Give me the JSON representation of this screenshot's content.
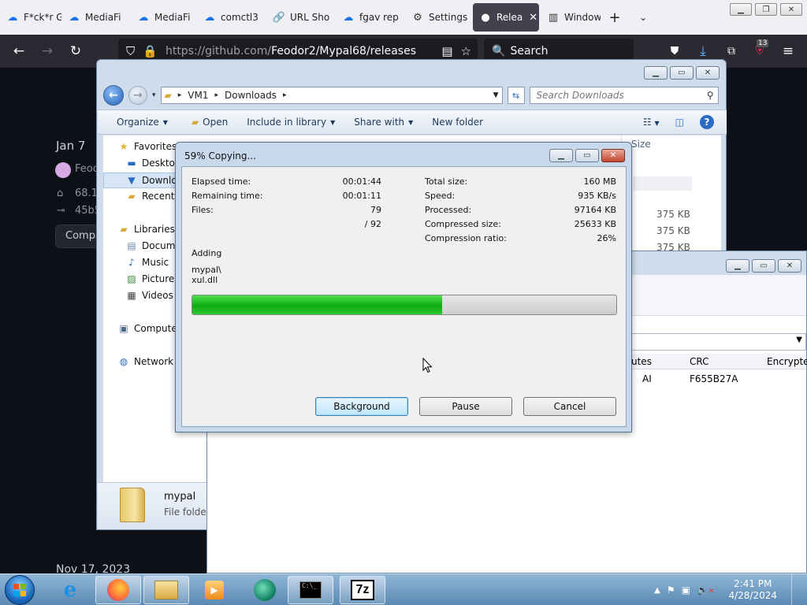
{
  "browser": {
    "tabs": [
      {
        "label": "F*ck*r G",
        "icon": "cloud-icon"
      },
      {
        "label": "MediaFi",
        "icon": "cloud-icon"
      },
      {
        "label": "MediaFi",
        "icon": "cloud-icon"
      },
      {
        "label": "comctl3",
        "icon": "cloud-icon"
      },
      {
        "label": "URL Sho",
        "icon": "link-icon"
      },
      {
        "label": "fgav rep",
        "icon": "cloud-icon"
      },
      {
        "label": "Settings",
        "icon": "gear-icon"
      },
      {
        "label": "Relea",
        "icon": "github-icon"
      },
      {
        "label": "Window",
        "icon": "library-icon"
      }
    ],
    "url_host": "https://github.com/",
    "url_path": "Feodor2/Mypal68/releases",
    "search_placeholder": "Search",
    "badge_count": "13"
  },
  "github": {
    "date1": "Jan 7",
    "author": "Feod",
    "tag": "68.1",
    "commit": "45b5",
    "compare_button": "Compa",
    "date2": "Nov 17, 2023"
  },
  "explorer": {
    "breadcrumb": [
      "VM1",
      "Downloads"
    ],
    "search_placeholder": "Search Downloads",
    "commands": [
      "Organize",
      "Open",
      "Include in library",
      "Share with",
      "New folder"
    ],
    "column_size": "Size",
    "nav": {
      "favorites": "Favorites",
      "desktop": "Desktop",
      "downloads": "Downlo",
      "recent": "Recent P",
      "libraries": "Libraries",
      "documents": "Docume",
      "music": "Music",
      "pictures": "Pictures",
      "videos": "Videos",
      "computer": "Compute",
      "network": "Network"
    },
    "file_sizes": [
      "375 KB",
      "375 KB",
      "375 KB"
    ],
    "details": {
      "name": "mypal",
      "type": "File folder"
    }
  },
  "zip_main": {
    "columns": {
      "attributes": "utes",
      "crc": "CRC",
      "encrypted": "Encrypte"
    },
    "row": {
      "attributes": "AI",
      "crc": "F655B27A"
    }
  },
  "copy_dialog": {
    "title": "59% Copying...",
    "elapsed_label": "Elapsed time:",
    "elapsed_value": "00:01:44",
    "remaining_label": "Remaining time:",
    "remaining_value": "00:01:11",
    "files_label": "Files:",
    "files_value": "79",
    "files_total": "/ 92",
    "total_size_label": "Total size:",
    "total_size_value": "160 MB",
    "speed_label": "Speed:",
    "speed_value": "935 KB/s",
    "processed_label": "Processed:",
    "processed_value": "97164 KB",
    "compressed_label": "Compressed size:",
    "compressed_value": "25633 KB",
    "ratio_label": "Compression ratio:",
    "ratio_value": "26%",
    "action": "Adding",
    "file_path_line1": "mypal\\",
    "file_path_line2": "xul.dll",
    "progress_fraction": 0.59,
    "buttons": {
      "background": "Background",
      "pause": "Pause",
      "cancel": "Cancel"
    }
  },
  "taskbar": {
    "time": "2:41 PM",
    "date": "4/28/2024",
    "zip_label": "7z"
  },
  "colors": {
    "progress_green": "#12b312",
    "github_bg": "#0d1117",
    "firefox_toolbar": "#2b2a33"
  }
}
